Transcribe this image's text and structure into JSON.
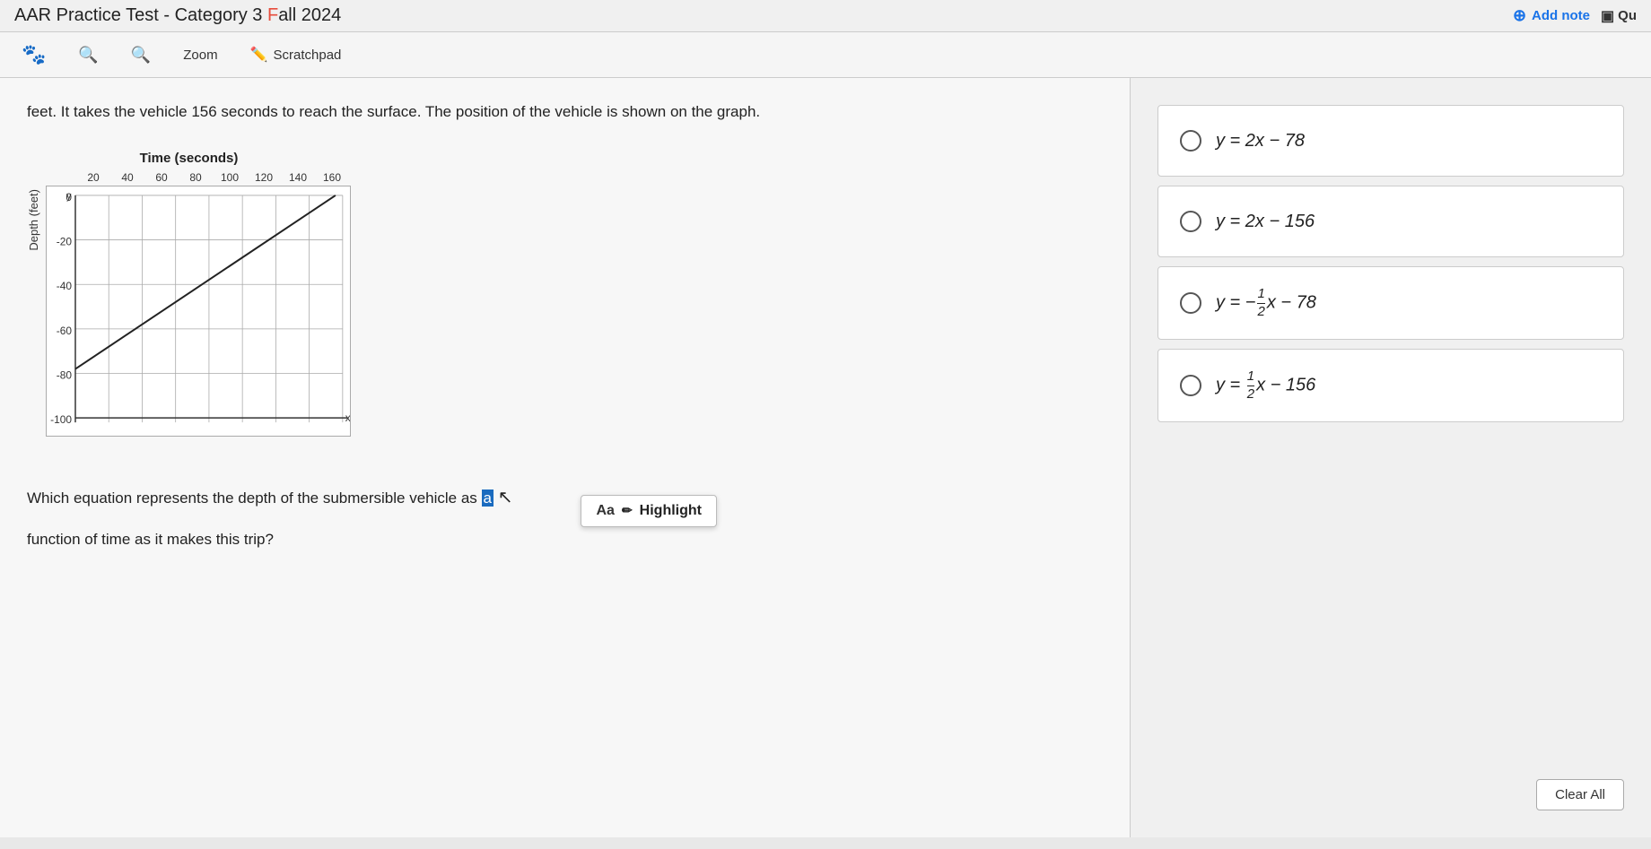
{
  "header": {
    "title": "AAR Practice Test - Category 3 Fall 2024",
    "title_highlight": "Fall",
    "add_note_label": "Add note",
    "qu_label": "Qu"
  },
  "toolbar": {
    "zoom_label": "Zoom",
    "scratchpad_label": "Scratchpad"
  },
  "question": {
    "intro_text": "feet. It takes the vehicle 156 seconds to reach the surface. The position of the vehicle is shown on the graph.",
    "graph_title": "Time (seconds)",
    "x_axis_labels": [
      "20",
      "40",
      "60",
      "80",
      "100",
      "120",
      "140",
      "160"
    ],
    "y_axis_label": "Depth (feet)",
    "y_axis_values": [
      "0",
      "-20",
      "-40",
      "-60",
      "-80",
      "-100"
    ],
    "bottom_text_before": "Which equation represents the depth of the submersible vehicle as ",
    "bottom_text_highlight": "a",
    "bottom_text_after": "function of time as it makes this trip?"
  },
  "highlight_tooltip": {
    "icon": "Aa",
    "label": "Highlight"
  },
  "answers": [
    {
      "id": "a",
      "formula": "y = 2x − 78",
      "selected": false
    },
    {
      "id": "b",
      "formula": "y = 2x − 156",
      "selected": false
    },
    {
      "id": "c",
      "formula": "y = −½x − 78",
      "selected": false
    },
    {
      "id": "d",
      "formula": "y = ½x − 156",
      "selected": false
    }
  ],
  "clear_all_label": "Clear All",
  "colors": {
    "accent": "#1a73e8",
    "highlight_bg": "#1a6bbf",
    "graph_line": "#000",
    "graph_grid": "#aaa"
  }
}
